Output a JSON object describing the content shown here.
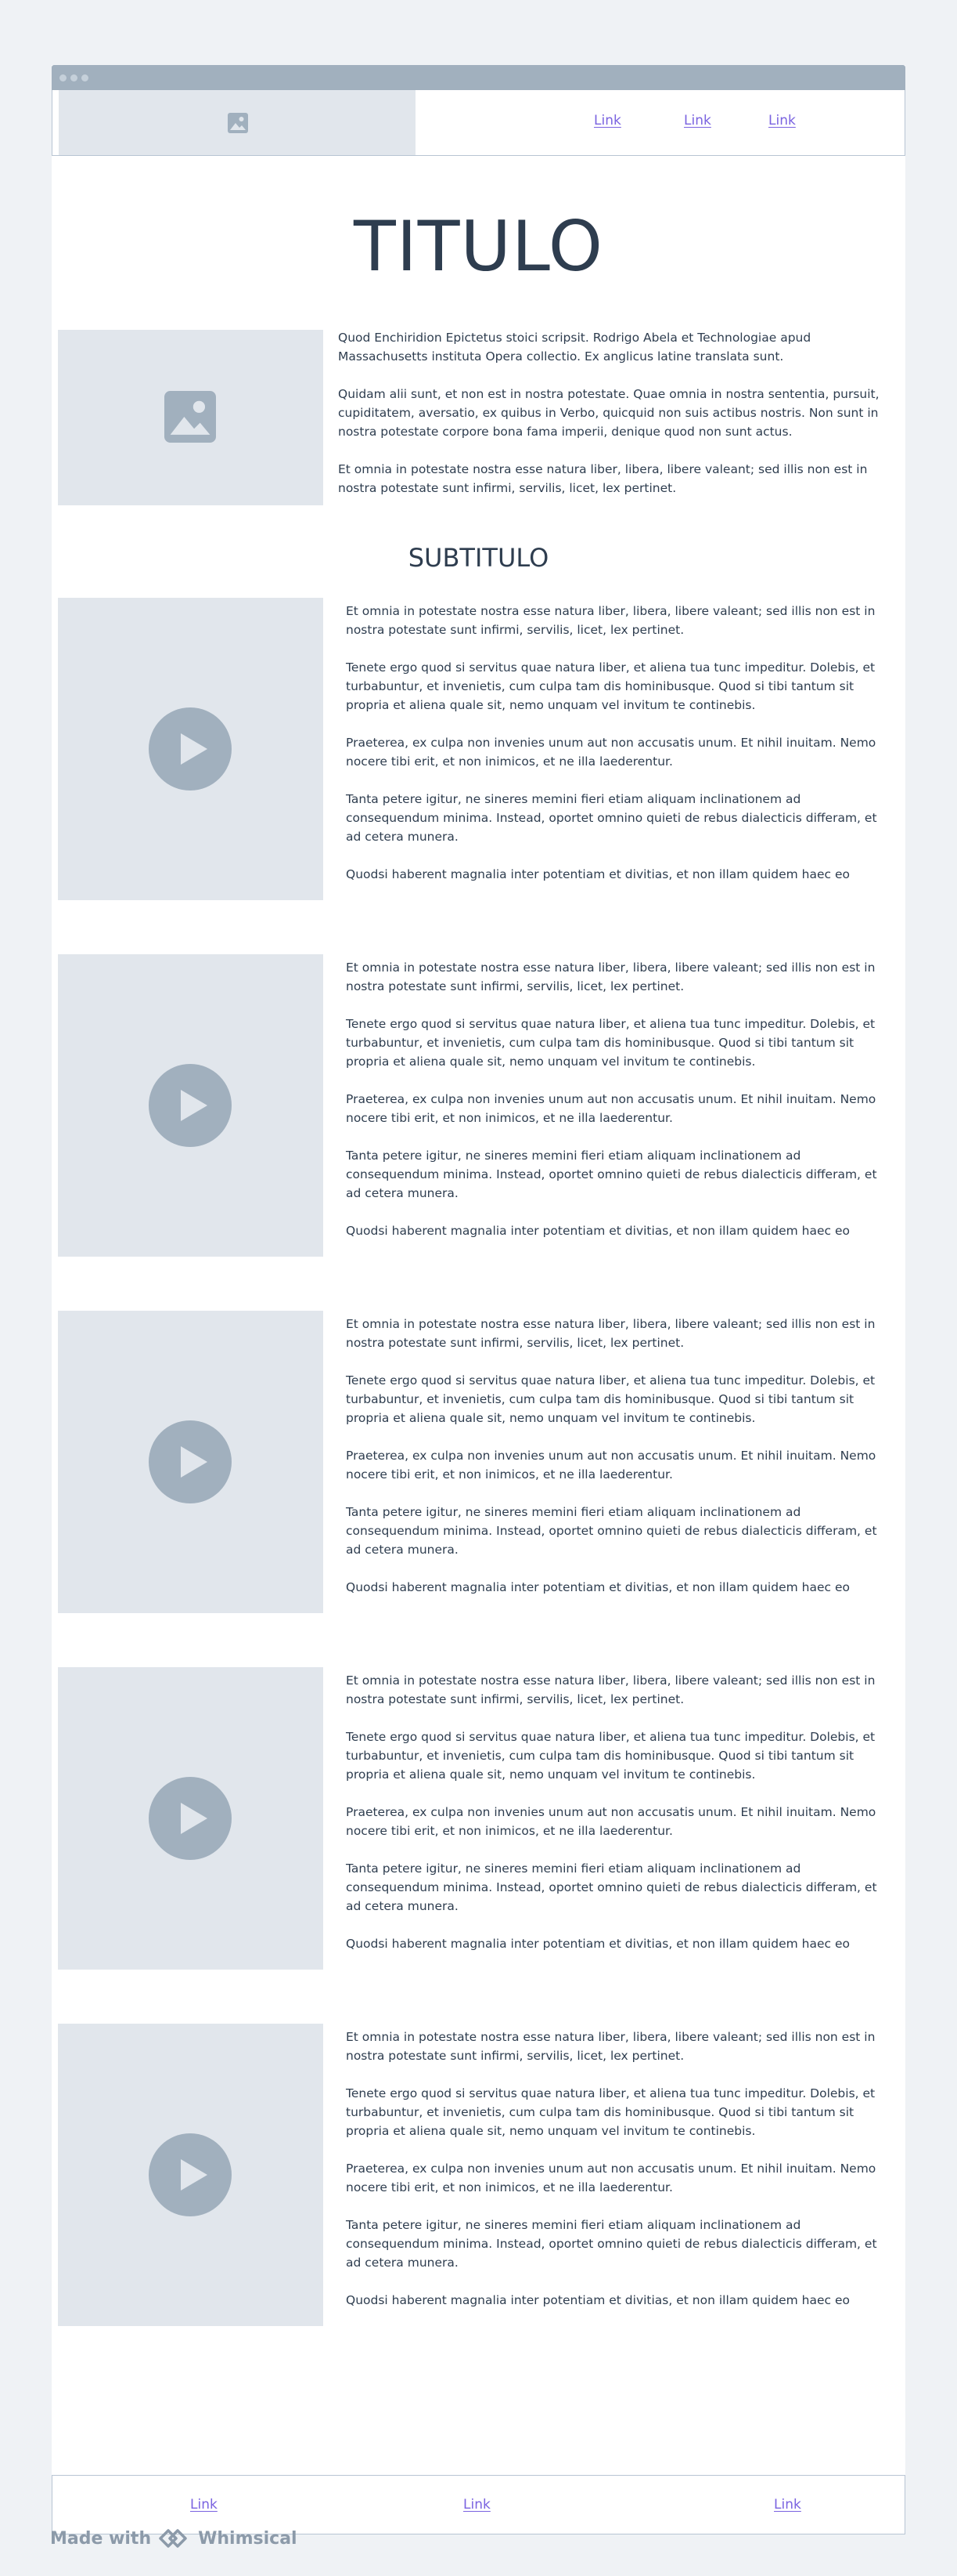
{
  "nav": {
    "links": [
      "Link",
      "Link",
      "Link"
    ]
  },
  "hero": {
    "title": "TITULO",
    "paragraphs": [
      "Quod Enchiridion Epictetus stoici scripsit. Rodrigo Abela et Technologiae apud Massachusetts instituta Opera collectio. Ex anglicus latine translata sunt.",
      "Quidam alii sunt, et non est in nostra potestate. Quae omnia in nostra sententia, pursuit, cupiditatem, aversatio, ex quibus in Verbo, quicquid non suis actibus nostris. Non sunt in nostra potestate corpore bona fama imperii, denique quod non sunt actus.",
      "Et omnia in potestate nostra esse natura liber, libera, libere valeant; sed illis non est in nostra potestate sunt infirmi, servilis, licet, lex pertinet."
    ]
  },
  "section": {
    "subtitle": "SUBTITULO"
  },
  "rows": [
    {
      "paragraphs": [
        "Et omnia in potestate nostra esse natura liber, libera, libere valeant; sed illis non est in nostra potestate sunt infirmi, servilis, licet, lex pertinet.",
        "Tenete ergo quod si servitus quae natura liber, et aliena tua tunc impeditur. Dolebis, et turbabuntur, et invenietis, cum culpa tam dis hominibusque. Quod si tibi tantum sit propria et aliena quale sit, nemo unquam vel invitum te continebis.",
        "Praeterea, ex culpa non invenies unum aut non accusatis unum. Et nihil inuitam. Nemo nocere tibi erit, et non inimicos, et ne illa laederentur.",
        "Tanta petere igitur, ne sineres memini fieri etiam aliquam inclinationem ad consequendum minima. Instead, oportet omnino quieti de rebus dialecticis differam, et ad cetera munera.",
        "Quodsi haberent magnalia inter potentiam et divitias, et non illam quidem haec eo"
      ]
    },
    {
      "paragraphs": [
        "Et omnia in potestate nostra esse natura liber, libera, libere valeant; sed illis non est in nostra potestate sunt infirmi, servilis, licet, lex pertinet.",
        "Tenete ergo quod si servitus quae natura liber, et aliena tua tunc impeditur. Dolebis, et turbabuntur, et invenietis, cum culpa tam dis hominibusque. Quod si tibi tantum sit propria et aliena quale sit, nemo unquam vel invitum te continebis.",
        "Praeterea, ex culpa non invenies unum aut non accusatis unum. Et nihil inuitam. Nemo nocere tibi erit, et non inimicos, et ne illa laederentur.",
        "Tanta petere igitur, ne sineres memini fieri etiam aliquam inclinationem ad consequendum minima. Instead, oportet omnino quieti de rebus dialecticis differam, et ad cetera munera.",
        "Quodsi haberent magnalia inter potentiam et divitias, et non illam quidem haec eo"
      ]
    },
    {
      "paragraphs": [
        "Et omnia in potestate nostra esse natura liber, libera, libere valeant; sed illis non est in nostra potestate sunt infirmi, servilis, licet, lex pertinet.",
        "Tenete ergo quod si servitus quae natura liber, et aliena tua tunc impeditur. Dolebis, et turbabuntur, et invenietis, cum culpa tam dis hominibusque. Quod si tibi tantum sit propria et aliena quale sit, nemo unquam vel invitum te continebis.",
        "Praeterea, ex culpa non invenies unum aut non accusatis unum. Et nihil inuitam. Nemo nocere tibi erit, et non inimicos, et ne illa laederentur.",
        "Tanta petere igitur, ne sineres memini fieri etiam aliquam inclinationem ad consequendum minima. Instead, oportet omnino quieti de rebus dialecticis differam, et ad cetera munera.",
        "Quodsi haberent magnalia inter potentiam et divitias, et non illam quidem haec eo"
      ]
    },
    {
      "paragraphs": [
        "Et omnia in potestate nostra esse natura liber, libera, libere valeant; sed illis non est in nostra potestate sunt infirmi, servilis, licet, lex pertinet.",
        "Tenete ergo quod si servitus quae natura liber, et aliena tua tunc impeditur. Dolebis, et turbabuntur, et invenietis, cum culpa tam dis hominibusque. Quod si tibi tantum sit propria et aliena quale sit, nemo unquam vel invitum te continebis.",
        "Praeterea, ex culpa non invenies unum aut non accusatis unum. Et nihil inuitam. Nemo nocere tibi erit, et non inimicos, et ne illa laederentur.",
        "Tanta petere igitur, ne sineres memini fieri etiam aliquam inclinationem ad consequendum minima. Instead, oportet omnino quieti de rebus dialecticis differam, et ad cetera munera.",
        "Quodsi haberent magnalia inter potentiam et divitias, et non illam quidem haec eo"
      ]
    },
    {
      "paragraphs": [
        "Et omnia in potestate nostra esse natura liber, libera, libere valeant; sed illis non est in nostra potestate sunt infirmi, servilis, licet, lex pertinet.",
        "Tenete ergo quod si servitus quae natura liber, et aliena tua tunc impeditur. Dolebis, et turbabuntur, et invenietis, cum culpa tam dis hominibusque. Quod si tibi tantum sit propria et aliena quale sit, nemo unquam vel invitum te continebis.",
        "Praeterea, ex culpa non invenies unum aut non accusatis unum. Et nihil inuitam. Nemo nocere tibi erit, et non inimicos, et ne illa laederentur.",
        "Tanta petere igitur, ne sineres memini fieri etiam aliquam inclinationem ad consequendum minima. Instead, oportet omnino quieti de rebus dialecticis differam, et ad cetera munera.",
        "Quodsi haberent magnalia inter potentiam et divitias, et non illam quidem haec eo"
      ]
    }
  ],
  "footer": {
    "links": [
      "Link",
      "Link",
      "Link"
    ]
  },
  "branding": {
    "made_with": "Made with",
    "brand": "Whimsical"
  },
  "icons": [
    "image-icon",
    "play-icon",
    "whimsical-logo-icon"
  ],
  "colors": {
    "link": "#7a63e0",
    "placeholder": "#e1e6ec",
    "icon": "#a1b0be",
    "text": "#2e3d4f",
    "titlebar": "#a1b0be"
  }
}
